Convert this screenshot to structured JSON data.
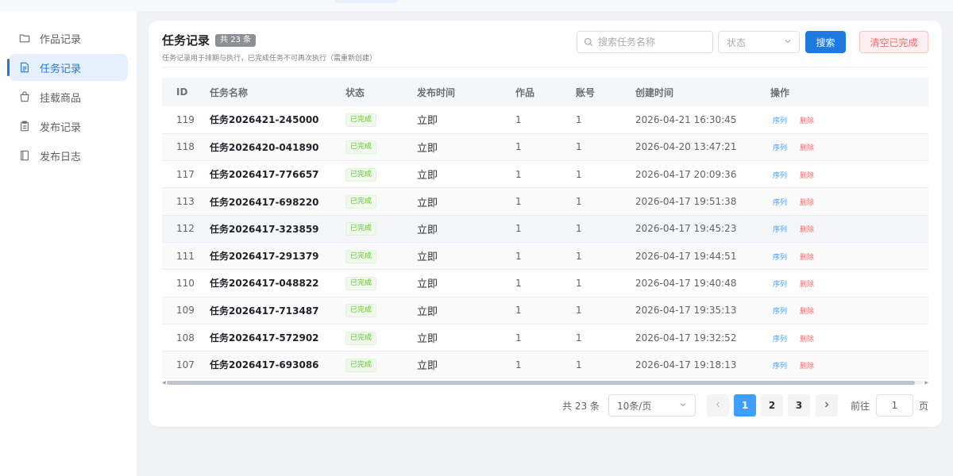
{
  "sidebar": {
    "items": [
      {
        "label": "作品记录",
        "icon": "folder-icon",
        "active": false
      },
      {
        "label": "任务记录",
        "icon": "document-icon",
        "active": true
      },
      {
        "label": "挂载商品",
        "icon": "shopping-bag-icon",
        "active": false
      },
      {
        "label": "发布记录",
        "icon": "clipboard-icon",
        "active": false
      },
      {
        "label": "发布日志",
        "icon": "book-icon",
        "active": false
      }
    ]
  },
  "header": {
    "title": "任务记录",
    "count_badge": "共 23 条",
    "subtitle": "任务记录用于排期与执行，已完成任务不可再次执行（需重新创建）"
  },
  "toolbar": {
    "search_placeholder": "搜索任务名称",
    "status_placeholder": "状态",
    "search_label": "搜索",
    "clear_label": "清空已完成"
  },
  "table": {
    "columns": [
      "ID",
      "任务名称",
      "状态",
      "发布时间",
      "作品",
      "账号",
      "创建时间",
      "操作"
    ],
    "rows": [
      {
        "id": "119",
        "name": "任务2026421-245000",
        "status": "已完成",
        "publish": "立即",
        "works": "1",
        "account": "1",
        "created": "2026-04-21 16:30:45",
        "op_seq": "序列",
        "op_del": "删除"
      },
      {
        "id": "118",
        "name": "任务2026420-041890",
        "status": "已完成",
        "publish": "立即",
        "works": "1",
        "account": "1",
        "created": "2026-04-20 13:47:21",
        "op_seq": "序列",
        "op_del": "删除"
      },
      {
        "id": "117",
        "name": "任务2026417-776657",
        "status": "已完成",
        "publish": "立即",
        "works": "1",
        "account": "1",
        "created": "2026-04-17 20:09:36",
        "op_seq": "序列",
        "op_del": "删除"
      },
      {
        "id": "113",
        "name": "任务2026417-698220",
        "status": "已完成",
        "publish": "立即",
        "works": "1",
        "account": "1",
        "created": "2026-04-17 19:51:38",
        "op_seq": "序列",
        "op_del": "删除"
      },
      {
        "id": "112",
        "name": "任务2026417-323859",
        "status": "已完成",
        "publish": "立即",
        "works": "1",
        "account": "1",
        "created": "2026-04-17 19:45:23",
        "op_seq": "序列",
        "op_del": "删除"
      },
      {
        "id": "111",
        "name": "任务2026417-291379",
        "status": "已完成",
        "publish": "立即",
        "works": "1",
        "account": "1",
        "created": "2026-04-17 19:44:51",
        "op_seq": "序列",
        "op_del": "删除"
      },
      {
        "id": "110",
        "name": "任务2026417-048822",
        "status": "已完成",
        "publish": "立即",
        "works": "1",
        "account": "1",
        "created": "2026-04-17 19:40:48",
        "op_seq": "序列",
        "op_del": "删除"
      },
      {
        "id": "109",
        "name": "任务2026417-713487",
        "status": "已完成",
        "publish": "立即",
        "works": "1",
        "account": "1",
        "created": "2026-04-17 19:35:13",
        "op_seq": "序列",
        "op_del": "删除"
      },
      {
        "id": "108",
        "name": "任务2026417-572902",
        "status": "已完成",
        "publish": "立即",
        "works": "1",
        "account": "1",
        "created": "2026-04-17 19:32:52",
        "op_seq": "序列",
        "op_del": "删除"
      },
      {
        "id": "107",
        "name": "任务2026417-693086",
        "status": "已完成",
        "publish": "立即",
        "works": "1",
        "account": "1",
        "created": "2026-04-17 19:18:13",
        "op_seq": "序列",
        "op_del": "删除"
      }
    ]
  },
  "pagination": {
    "total": "共 23 条",
    "page_size": "10条/页",
    "pages": [
      "1",
      "2",
      "3"
    ],
    "current": "1",
    "goto_label": "前往",
    "goto_value": "1",
    "page_suffix": "页"
  },
  "colors": {
    "accent": "#1f7ae0",
    "danger": "#f56c6c",
    "success": "#67c23a"
  }
}
